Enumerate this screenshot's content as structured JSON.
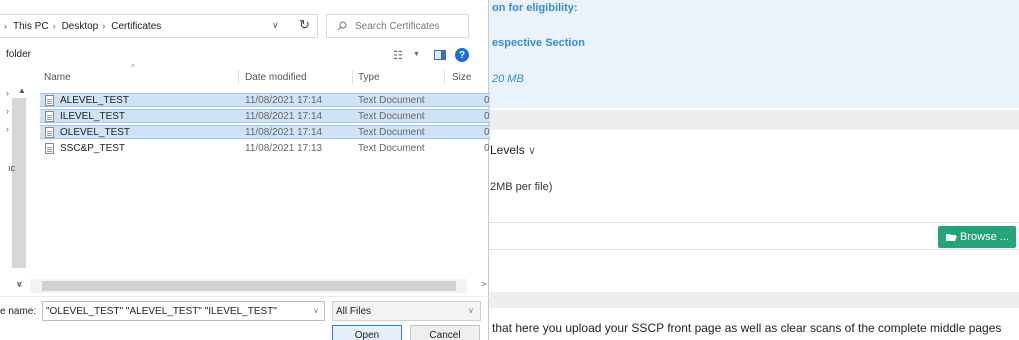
{
  "web": {
    "cutoff_text": "on for eligibility:",
    "respective_text": "espective Section",
    "size_text": "20 MB",
    "levels_text": "Levels",
    "per_file_text": "2MB per file)",
    "browse_label": "Browse ...",
    "note_text": "that here you upload your SSCP front page as well as clear scans of the complete middle pages",
    "accent_color": "#3a8bd0",
    "browse_color": "#27a37a"
  },
  "dialog": {
    "breadcrumb": [
      "This PC",
      "Desktop",
      "Certificates"
    ],
    "search_placeholder": "Search Certificates",
    "toolbar_label": "folder",
    "nav_stub": "ıc",
    "columns": {
      "name": "Name",
      "date": "Date modified",
      "type": "Type",
      "size": "Size"
    },
    "files": [
      {
        "name": "ALEVEL_TEST",
        "date": "11/08/2021 17:14",
        "type": "Text Document",
        "size": "0",
        "selected": true
      },
      {
        "name": "ILEVEL_TEST",
        "date": "11/08/2021 17:14",
        "type": "Text Document",
        "size": "0",
        "selected": true
      },
      {
        "name": "OLEVEL_TEST",
        "date": "11/08/2021 17:14",
        "type": "Text Document",
        "size": "0",
        "selected": true
      },
      {
        "name": "SSC&P_TEST",
        "date": "11/08/2021 17:13",
        "type": "Text Document",
        "size": "0",
        "selected": false
      }
    ],
    "file_name_label": "e name:",
    "file_name_value": "\"OLEVEL_TEST\" \"ALEVEL_TEST\" \"ILEVEL_TEST\"",
    "file_type": "All Files",
    "open_label": "Open",
    "cancel_label": "Cancel",
    "selection_color": "#cfe3f7"
  }
}
